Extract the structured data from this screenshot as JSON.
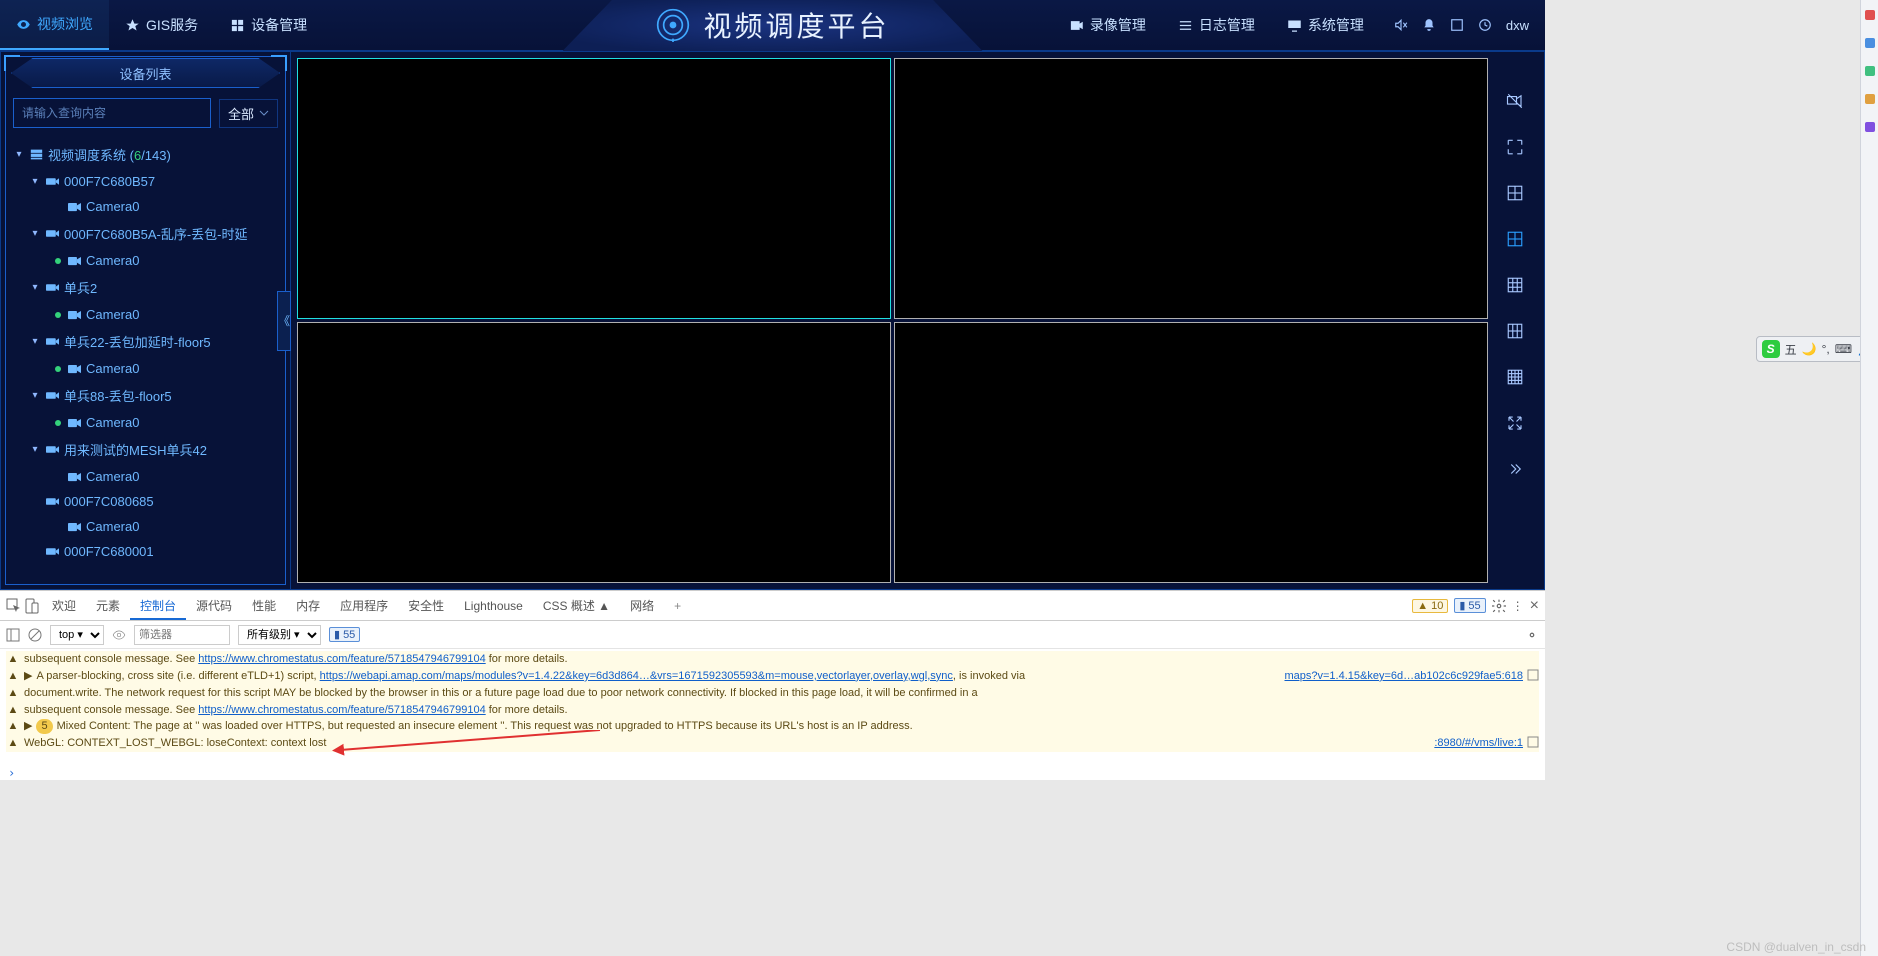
{
  "header": {
    "title": "视频调度平台",
    "nav_left": [
      {
        "label": "视频浏览",
        "icon": "eye",
        "active": true
      },
      {
        "label": "GIS服务",
        "icon": "location",
        "active": false
      },
      {
        "label": "设备管理",
        "icon": "grid",
        "active": false
      }
    ],
    "nav_right": [
      {
        "label": "录像管理",
        "icon": "video"
      },
      {
        "label": "日志管理",
        "icon": "list"
      },
      {
        "label": "系统管理",
        "icon": "monitor"
      }
    ],
    "user": "dxw"
  },
  "sidebar": {
    "title": "设备列表",
    "search_placeholder": "请输入查询内容",
    "filter_label": "全部",
    "collapse_glyph": "《",
    "root": {
      "label": "视频调度系统",
      "online": "6",
      "total": "143"
    },
    "nodes": [
      {
        "type": "device",
        "label": "000F7C680B57",
        "children": [
          {
            "label": "Camera0",
            "online": false
          }
        ]
      },
      {
        "type": "device",
        "label": "000F7C680B5A-乱序-丢包-时延",
        "children": [
          {
            "label": "Camera0",
            "online": true
          }
        ]
      },
      {
        "type": "device",
        "label": "单兵2",
        "children": [
          {
            "label": "Camera0",
            "online": true
          }
        ]
      },
      {
        "type": "device",
        "label": "单兵22-丢包加延时-floor5",
        "children": [
          {
            "label": "Camera0",
            "online": true
          }
        ]
      },
      {
        "type": "device",
        "label": "单兵88-丢包-floor5",
        "children": [
          {
            "label": "Camera0",
            "online": true
          }
        ]
      },
      {
        "type": "device",
        "label": "用来测试的MESH单兵42",
        "children": [
          {
            "label": "Camera0",
            "online": false
          }
        ]
      },
      {
        "type": "device",
        "label": "000F7C080685",
        "children": [
          {
            "label": "Camera0",
            "online": false
          }
        ],
        "noCaret": true
      },
      {
        "type": "device",
        "label": "000F7C680001",
        "children": [],
        "noCaret": true
      }
    ]
  },
  "grid": {
    "active_cell": 0,
    "layout": "2x2"
  },
  "right_tools": [
    {
      "name": "camera-off-icon"
    },
    {
      "name": "fullscreen-icon"
    },
    {
      "name": "grid-1x1-icon"
    },
    {
      "name": "grid-2x2-icon",
      "active": true
    },
    {
      "name": "grid-3x3-icon"
    },
    {
      "name": "grid-4x3-icon"
    },
    {
      "name": "grid-4x4-icon"
    },
    {
      "name": "expand-icon"
    },
    {
      "name": "more-icon"
    }
  ],
  "devtools": {
    "tabs": [
      "欢迎",
      "元素",
      "控制台",
      "源代码",
      "性能",
      "内存",
      "应用程序",
      "安全性",
      "Lighthouse",
      "CSS 概述 ▲",
      "网络"
    ],
    "active_tab": "控制台",
    "counts": {
      "warn": "10",
      "info": "55"
    },
    "toolbar": {
      "context": "top ▾",
      "filter_placeholder": "筛选器",
      "level": "所有级别 ▾",
      "info_count": "55"
    },
    "lines": [
      {
        "type": "warn",
        "text_parts": [
          "subsequent console message. See ",
          {
            "link": "https://www.chromestatus.com/feature/5718547946799104"
          },
          " for more details."
        ]
      },
      {
        "type": "warn",
        "prefix": "▶",
        "text_parts": [
          "A parser-blocking, cross site (i.e. different eTLD+1) script, ",
          {
            "link": "https://webapi.amap.com/maps/modules?v=1.4.22&key=6d3d864…&vrs=1671592305593&m=mouse,vectorlayer,overlay,wgl,sync"
          },
          ", is invoked via"
        ],
        "src": "maps?v=1.4.15&key=6d…ab102c6c929fae5:618"
      },
      {
        "type": "warn",
        "text_parts": [
          "document.write. The network request for this script MAY be blocked by the browser in this or a future page load due to poor network connectivity. If blocked in this page load, it will be confirmed in a"
        ]
      },
      {
        "type": "warn",
        "text_parts": [
          "subsequent console message. See ",
          {
            "link": "https://www.chromestatus.com/feature/5718547946799104"
          },
          " for more details."
        ]
      },
      {
        "type": "warn",
        "prefix": "▶",
        "badge": "5",
        "text_parts": [
          "Mixed Content: The page at '<URL>' was loaded over HTTPS, but requested an insecure element '<URL>'. This request was not upgraded to HTTPS because its URL's host is an IP address."
        ]
      },
      {
        "type": "warn",
        "text_parts": [
          "WebGL: CONTEXT_LOST_WEBGL: loseContext: context lost"
        ],
        "src": ":8980/#/vms/live:1"
      }
    ],
    "prompt": "›"
  },
  "ime": {
    "badge": "S",
    "label": "五",
    "icons": [
      "🌙",
      "°,",
      "⌨",
      "👤"
    ]
  },
  "watermark": "CSDN @dualven_in_csdn"
}
